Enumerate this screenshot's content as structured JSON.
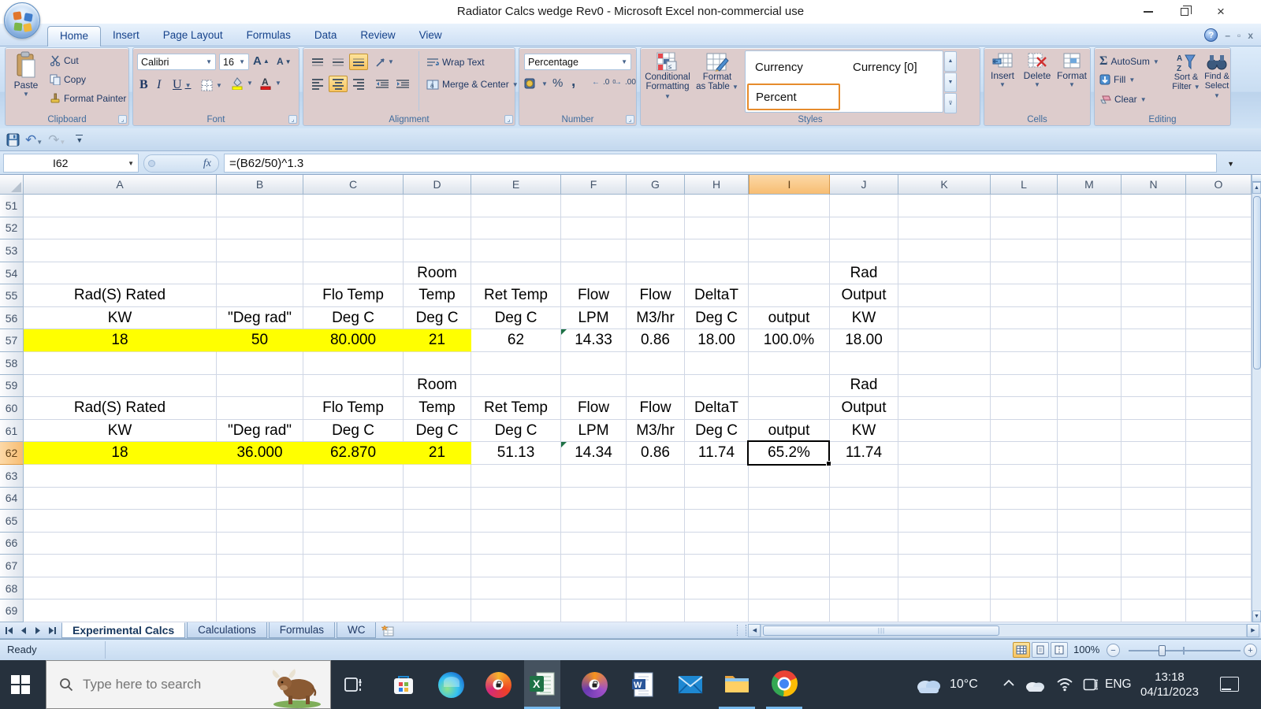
{
  "window": {
    "title": "Radiator Calcs wedge Rev0 - Microsoft Excel non-commercial use"
  },
  "colors": {
    "cell_highlight_yellow": "#ffff00",
    "header_selection_orange": "#f7bd72",
    "taskbar_accent_blue": "#76b9ed",
    "style_selected_border": "#e68b2c"
  },
  "ribbon": {
    "tabs": [
      {
        "label": "Home",
        "active": true
      },
      {
        "label": "Insert"
      },
      {
        "label": "Page Layout"
      },
      {
        "label": "Formulas"
      },
      {
        "label": "Data"
      },
      {
        "label": "Review"
      },
      {
        "label": "View"
      }
    ],
    "clipboard": {
      "label": "Clipboard",
      "paste": "Paste",
      "cut": "Cut",
      "copy": "Copy",
      "format_painter": "Format Painter"
    },
    "font": {
      "label": "Font",
      "font_name": "Calibri",
      "font_size": "16",
      "bold": "B",
      "italic": "I",
      "underline": "U"
    },
    "alignment": {
      "label": "Alignment",
      "wrap_text": "Wrap Text",
      "merge_center": "Merge & Center"
    },
    "number": {
      "label": "Number",
      "format": "Percentage",
      "percent_sign": "%",
      "comma": ","
    },
    "styles": {
      "label": "Styles",
      "conditional_line1": "Conditional",
      "conditional_line2": "Formatting",
      "format_table_line1": "Format",
      "format_table_line2": "as Table",
      "gallery": [
        {
          "label": "Currency"
        },
        {
          "label": "Currency [0]"
        },
        {
          "label": "Percent",
          "selected": true
        }
      ]
    },
    "cells": {
      "label": "Cells",
      "insert": "Insert",
      "delete": "Delete",
      "format": "Format"
    },
    "editing": {
      "label": "Editing",
      "autosum": "AutoSum",
      "fill": "Fill",
      "clear": "Clear",
      "sort_line1": "Sort &",
      "sort_line2": "Filter",
      "find_line1": "Find &",
      "find_line2": "Select"
    }
  },
  "formula_bar": {
    "name_box": "I62",
    "fx_label": "fx",
    "formula": "=(B62/50)^1.3"
  },
  "grid": {
    "columns": [
      "A",
      "B",
      "C",
      "D",
      "E",
      "F",
      "G",
      "H",
      "I",
      "J",
      "K",
      "L",
      "M",
      "N",
      "O"
    ],
    "selected": {
      "row": 62,
      "col": "I"
    },
    "rows": [
      {
        "num": 51,
        "cells": {}
      },
      {
        "num": 52,
        "cells": {}
      },
      {
        "num": 53,
        "cells": {}
      },
      {
        "num": 54,
        "cells": {
          "D": "Room",
          "J": "Rad"
        }
      },
      {
        "num": 55,
        "cells": {
          "A": "Rad(S) Rated",
          "C": "Flo Temp",
          "D": "Temp",
          "E": "Ret Temp",
          "F": "Flow",
          "G": "Flow",
          "H": "DeltaT",
          "J": "Output"
        }
      },
      {
        "num": 56,
        "cells": {
          "A": "KW",
          "B": "\"Deg rad\"",
          "C": "Deg C",
          "D": "Deg C",
          "E": "Deg C",
          "F": "LPM",
          "G": "M3/hr",
          "H": "Deg C",
          "I": "output",
          "J": "KW"
        }
      },
      {
        "num": 57,
        "cells": {
          "A": "18",
          "B": "50",
          "C": "80.000",
          "D": "21",
          "E": "62",
          "F": "14.33",
          "G": "0.86",
          "H": "18.00",
          "I": "100.0%",
          "J": "18.00"
        },
        "yellow": [
          "A",
          "B",
          "C",
          "D"
        ],
        "flagged": [
          "F"
        ]
      },
      {
        "num": 58,
        "cells": {}
      },
      {
        "num": 59,
        "cells": {
          "D": "Room",
          "J": "Rad"
        }
      },
      {
        "num": 60,
        "cells": {
          "A": "Rad(S) Rated",
          "C": "Flo Temp",
          "D": "Temp",
          "E": "Ret Temp",
          "F": "Flow",
          "G": "Flow",
          "H": "DeltaT",
          "J": "Output"
        }
      },
      {
        "num": 61,
        "cells": {
          "A": "KW",
          "B": "\"Deg rad\"",
          "C": "Deg C",
          "D": "Deg C",
          "E": "Deg C",
          "F": "LPM",
          "G": "M3/hr",
          "H": "Deg C",
          "I": "output",
          "J": "KW"
        }
      },
      {
        "num": 62,
        "cells": {
          "A": "18",
          "B": "36.000",
          "C": "62.870",
          "D": "21",
          "E": "51.13",
          "F": "14.34",
          "G": "0.86",
          "H": "11.74",
          "I": "65.2%",
          "J": "11.74"
        },
        "yellow": [
          "A",
          "B",
          "C",
          "D"
        ],
        "flagged": [
          "F"
        ]
      },
      {
        "num": 63,
        "cells": {}
      },
      {
        "num": 64,
        "cells": {}
      },
      {
        "num": 65,
        "cells": {}
      },
      {
        "num": 66,
        "cells": {}
      },
      {
        "num": 67,
        "cells": {}
      },
      {
        "num": 68,
        "cells": {}
      },
      {
        "num": 69,
        "cells": {}
      }
    ]
  },
  "sheet_bar": {
    "tabs": [
      {
        "label": "Experimental Calcs",
        "active": true
      },
      {
        "label": "Calculations"
      },
      {
        "label": "Formulas"
      },
      {
        "label": "WC"
      }
    ]
  },
  "status_bar": {
    "mode": "Ready",
    "zoom": "100%"
  },
  "taskbar": {
    "search_placeholder": "Type here to search",
    "tray": {
      "temperature": "10°C",
      "language": "ENG",
      "time": "13:18",
      "date": "04/11/2023"
    }
  }
}
